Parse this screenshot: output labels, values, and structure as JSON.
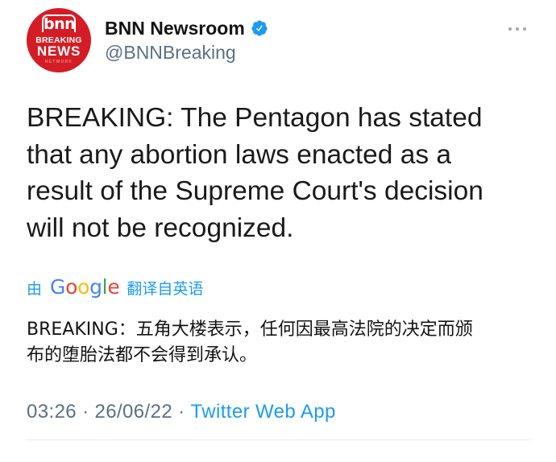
{
  "author": {
    "avatar": {
      "logo_text": "bnn",
      "tagline_top": "BREAKING",
      "tagline_main": "NEWS",
      "tagline_small": "NETWORK",
      "background": "#d41c24"
    },
    "name": "BNN Newsroom",
    "verified_icon": "verified-badge-icon",
    "handle": "@BNNBreaking"
  },
  "more_options_icon": "more-options-icon",
  "tweet": {
    "text_lines": [
      "BREAKING: The Pentagon has stated",
      "that any abortion laws enacted as a",
      "result of the Supreme Court's decision",
      "will not be recognized."
    ]
  },
  "translation": {
    "prefix": "由",
    "provider": "Google",
    "provider_letter_colors": [
      "#4285F4",
      "#EA4335",
      "#FBBC05",
      "#4285F4",
      "#34A853",
      "#EA4335"
    ],
    "suffix": "翻译自英语",
    "text_lines": [
      "BREAKING：五角大楼表示，任何因最高法院的决定而颁",
      "布的堕胎法都不会得到承认。"
    ]
  },
  "meta": {
    "time": "03:26",
    "separator": "·",
    "date": "26/06/22",
    "source": "Twitter Web App"
  },
  "colors": {
    "text": "#1a1a1a",
    "secondary": "#5b7083",
    "link": "#1d9bf0",
    "verified": "#1d9bf0",
    "divider": "#e6ecf0"
  }
}
